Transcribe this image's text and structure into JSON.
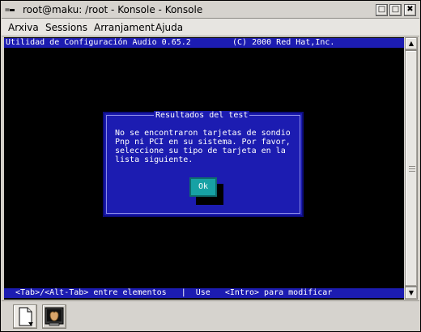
{
  "window": {
    "title": "root@maku: /root - Konsole - Konsole",
    "sysmenu_glyph": "=▬",
    "buttons": {
      "minimize": "□",
      "maximize": "□",
      "close": "✖"
    }
  },
  "menubar": {
    "items": [
      "Arxiva",
      "Sessions",
      "Arranjament",
      "Ajuda"
    ]
  },
  "terminal": {
    "header_left": "Utilidad de Configuración Audio 0.65.2",
    "header_right": "(C) 2000 Red Hat,Inc.",
    "footer": "<Tab>/<Alt-Tab> entre elementos   |  Use   <Intro> para modificar",
    "colors": {
      "background": "#000000",
      "bar": "#1c1cb1",
      "dialog": "#1c1cb1",
      "button": "#17a1a4"
    }
  },
  "dialog": {
    "title": "Resultados del test",
    "message": "No se encontraron tarjetas de sondio\nPnp ni PCI en su sistema. Por favor,\nseleccione su tipo de tarjeta en la\nlista siguiente.",
    "ok_label": "Ok"
  },
  "scrollbar": {
    "up_glyph": "▲",
    "down_glyph": "▼"
  },
  "toolbar": {
    "icons": [
      "new-session-icon",
      "konsole-session-icon"
    ]
  }
}
